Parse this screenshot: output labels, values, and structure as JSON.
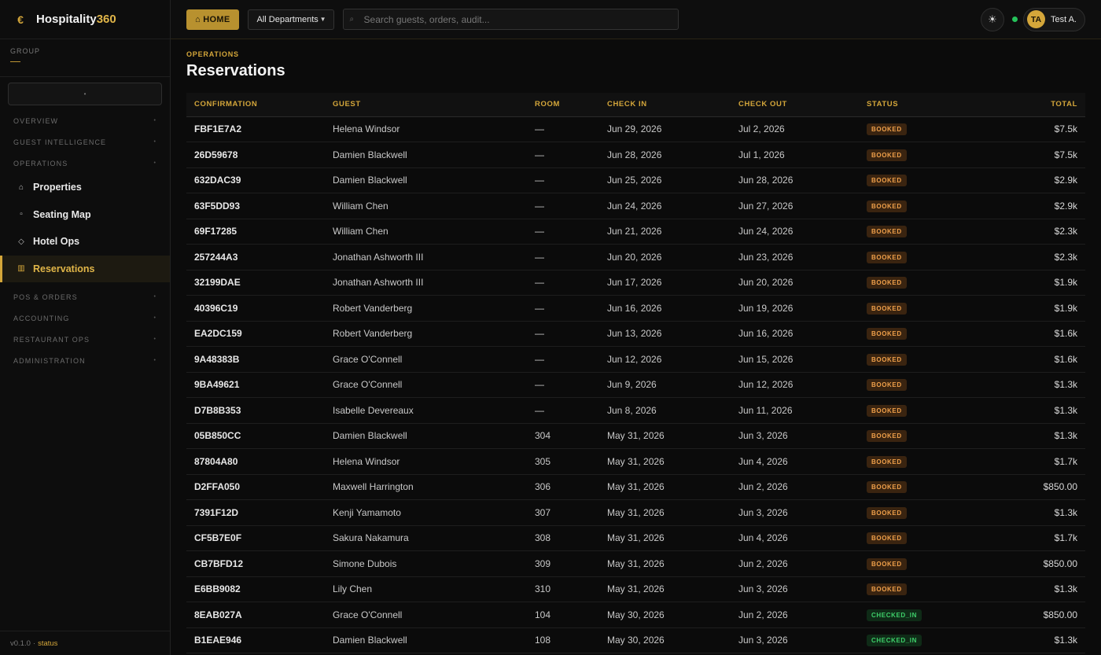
{
  "brand": {
    "name_main": "Hospitality",
    "name_accent": "360"
  },
  "group": {
    "label": "GROUP",
    "value": "—"
  },
  "sidebar": {
    "sections_top": [
      {
        "label": "OVERVIEW"
      },
      {
        "label": "GUEST INTELLIGENCE"
      },
      {
        "label": "OPERATIONS"
      }
    ],
    "items": [
      {
        "label": "Properties",
        "icon": "home-icon"
      },
      {
        "label": "Seating Map",
        "icon": "square-icon"
      },
      {
        "label": "Hotel Ops",
        "icon": "diamond-icon"
      },
      {
        "label": "Reservations",
        "icon": "grid-icon"
      }
    ],
    "sections_bottom": [
      {
        "label": "POS & ORDERS"
      },
      {
        "label": "ACCOUNTING"
      },
      {
        "label": "RESTAURANT OPS"
      },
      {
        "label": "ADMINISTRATION"
      }
    ],
    "footer": {
      "version": "v0.1.0",
      "separator": "·",
      "status_link": "status"
    }
  },
  "topbar": {
    "home_label": "⌂ HOME",
    "department": "All Departments",
    "search_placeholder": "Search guests, orders, audit...",
    "user_initials": "TA",
    "user_name": "Test A."
  },
  "page": {
    "breadcrumb": "OPERATIONS",
    "title": "Reservations"
  },
  "table": {
    "headers": {
      "confirmation": "CONFIRMATION",
      "guest": "GUEST",
      "room": "ROOM",
      "check_in": "CHECK IN",
      "check_out": "CHECK OUT",
      "status": "STATUS",
      "total": "TOTAL"
    },
    "rows": [
      {
        "confirmation": "FBF1E7A2",
        "guest": "Helena Windsor",
        "room": "—",
        "check_in": "Jun 29, 2026",
        "check_out": "Jul 2, 2026",
        "status": "BOOKED",
        "total": "$7.5k"
      },
      {
        "confirmation": "26D59678",
        "guest": "Damien Blackwell",
        "room": "—",
        "check_in": "Jun 28, 2026",
        "check_out": "Jul 1, 2026",
        "status": "BOOKED",
        "total": "$7.5k"
      },
      {
        "confirmation": "632DAC39",
        "guest": "Damien Blackwell",
        "room": "—",
        "check_in": "Jun 25, 2026",
        "check_out": "Jun 28, 2026",
        "status": "BOOKED",
        "total": "$2.9k"
      },
      {
        "confirmation": "63F5DD93",
        "guest": "William Chen",
        "room": "—",
        "check_in": "Jun 24, 2026",
        "check_out": "Jun 27, 2026",
        "status": "BOOKED",
        "total": "$2.9k"
      },
      {
        "confirmation": "69F17285",
        "guest": "William Chen",
        "room": "—",
        "check_in": "Jun 21, 2026",
        "check_out": "Jun 24, 2026",
        "status": "BOOKED",
        "total": "$2.3k"
      },
      {
        "confirmation": "257244A3",
        "guest": "Jonathan Ashworth III",
        "room": "—",
        "check_in": "Jun 20, 2026",
        "check_out": "Jun 23, 2026",
        "status": "BOOKED",
        "total": "$2.3k"
      },
      {
        "confirmation": "32199DAE",
        "guest": "Jonathan Ashworth III",
        "room": "—",
        "check_in": "Jun 17, 2026",
        "check_out": "Jun 20, 2026",
        "status": "BOOKED",
        "total": "$1.9k"
      },
      {
        "confirmation": "40396C19",
        "guest": "Robert Vanderberg",
        "room": "—",
        "check_in": "Jun 16, 2026",
        "check_out": "Jun 19, 2026",
        "status": "BOOKED",
        "total": "$1.9k"
      },
      {
        "confirmation": "EA2DC159",
        "guest": "Robert Vanderberg",
        "room": "—",
        "check_in": "Jun 13, 2026",
        "check_out": "Jun 16, 2026",
        "status": "BOOKED",
        "total": "$1.6k"
      },
      {
        "confirmation": "9A48383B",
        "guest": "Grace O'Connell",
        "room": "—",
        "check_in": "Jun 12, 2026",
        "check_out": "Jun 15, 2026",
        "status": "BOOKED",
        "total": "$1.6k"
      },
      {
        "confirmation": "9BA49621",
        "guest": "Grace O'Connell",
        "room": "—",
        "check_in": "Jun 9, 2026",
        "check_out": "Jun 12, 2026",
        "status": "BOOKED",
        "total": "$1.3k"
      },
      {
        "confirmation": "D7B8B353",
        "guest": "Isabelle Devereaux",
        "room": "—",
        "check_in": "Jun 8, 2026",
        "check_out": "Jun 11, 2026",
        "status": "BOOKED",
        "total": "$1.3k"
      },
      {
        "confirmation": "05B850CC",
        "guest": "Damien Blackwell",
        "room": "304",
        "check_in": "May 31, 2026",
        "check_out": "Jun 3, 2026",
        "status": "BOOKED",
        "total": "$1.3k"
      },
      {
        "confirmation": "87804A80",
        "guest": "Helena Windsor",
        "room": "305",
        "check_in": "May 31, 2026",
        "check_out": "Jun 4, 2026",
        "status": "BOOKED",
        "total": "$1.7k"
      },
      {
        "confirmation": "D2FFA050",
        "guest": "Maxwell Harrington",
        "room": "306",
        "check_in": "May 31, 2026",
        "check_out": "Jun 2, 2026",
        "status": "BOOKED",
        "total": "$850.00"
      },
      {
        "confirmation": "7391F12D",
        "guest": "Kenji Yamamoto",
        "room": "307",
        "check_in": "May 31, 2026",
        "check_out": "Jun 3, 2026",
        "status": "BOOKED",
        "total": "$1.3k"
      },
      {
        "confirmation": "CF5B7E0F",
        "guest": "Sakura Nakamura",
        "room": "308",
        "check_in": "May 31, 2026",
        "check_out": "Jun 4, 2026",
        "status": "BOOKED",
        "total": "$1.7k"
      },
      {
        "confirmation": "CB7BFD12",
        "guest": "Simone Dubois",
        "room": "309",
        "check_in": "May 31, 2026",
        "check_out": "Jun 2, 2026",
        "status": "BOOKED",
        "total": "$850.00"
      },
      {
        "confirmation": "E6BB9082",
        "guest": "Lily Chen",
        "room": "310",
        "check_in": "May 31, 2026",
        "check_out": "Jun 3, 2026",
        "status": "BOOKED",
        "total": "$1.3k"
      },
      {
        "confirmation": "8EAB027A",
        "guest": "Grace O'Connell",
        "room": "104",
        "check_in": "May 30, 2026",
        "check_out": "Jun 2, 2026",
        "status": "CHECKED_IN",
        "total": "$850.00"
      },
      {
        "confirmation": "B1EAE946",
        "guest": "Damien Blackwell",
        "room": "108",
        "check_in": "May 30, 2026",
        "check_out": "Jun 3, 2026",
        "status": "CHECKED_IN",
        "total": "$1.3k"
      }
    ]
  },
  "colors": {
    "accent": "#d4a63a",
    "background": "#0b0b0b",
    "booked_badge": "#f0a04a",
    "checked_in_badge": "#3ed06a",
    "online": "#25c25a"
  }
}
